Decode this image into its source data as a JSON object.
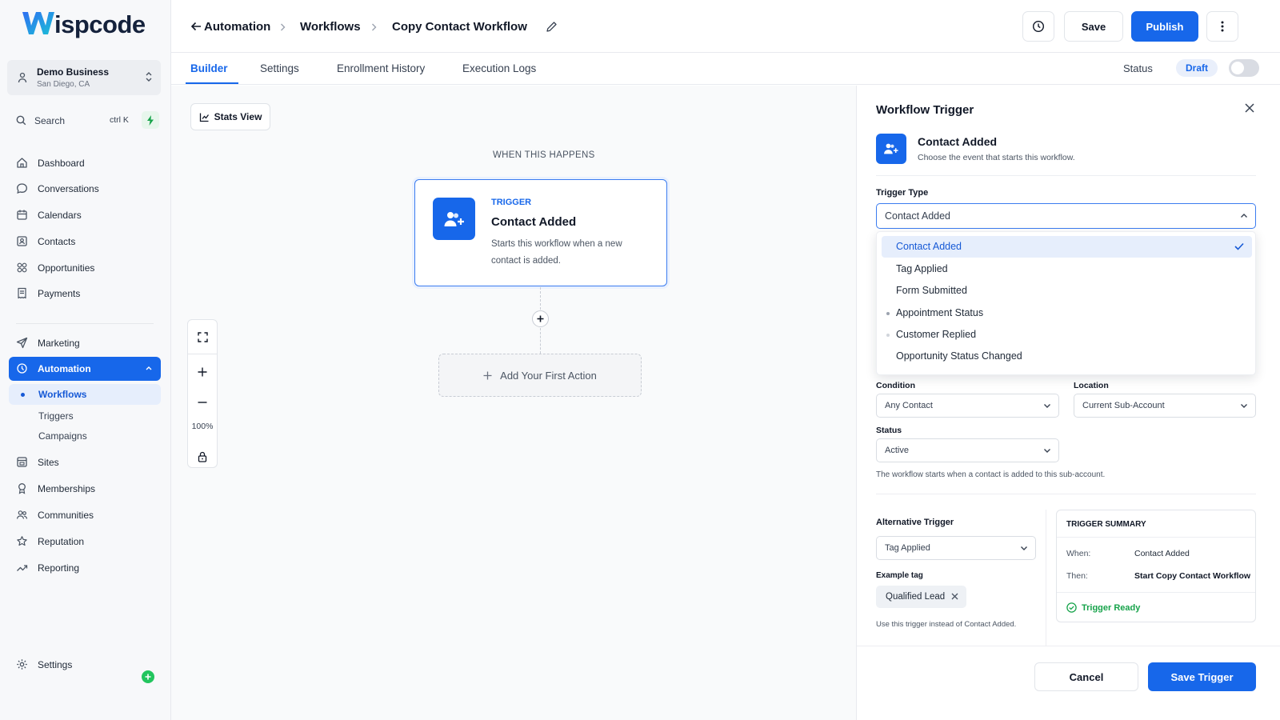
{
  "brand": {
    "name": "ispcode",
    "accent": "#1767ea"
  },
  "account": {
    "name": "Demo Business",
    "location": "San Diego, CA"
  },
  "search": {
    "placeholder": "Search",
    "shortcut": "ctrl K"
  },
  "nav": {
    "main": [
      {
        "label": "Dashboard",
        "icon": "home-icon"
      },
      {
        "label": "Conversations",
        "icon": "chat-icon"
      },
      {
        "label": "Calendars",
        "icon": "calendar-icon"
      },
      {
        "label": "Contacts",
        "icon": "contact-card-icon"
      },
      {
        "label": "Opportunities",
        "icon": "opportunities-icon"
      },
      {
        "label": "Payments",
        "icon": "receipt-icon"
      }
    ],
    "marketing": {
      "label": "Marketing",
      "icon": "send-icon"
    },
    "automation": {
      "label": "Automation",
      "icon": "automation-icon"
    },
    "automation_sub": [
      "Workflows",
      "Triggers",
      "Campaigns"
    ],
    "more": [
      {
        "label": "Sites",
        "icon": "browser-icon"
      },
      {
        "label": "Memberships",
        "icon": "award-icon"
      },
      {
        "label": "Communities",
        "icon": "users-icon"
      },
      {
        "label": "Reputation",
        "icon": "star-icon"
      },
      {
        "label": "Reporting",
        "icon": "trend-icon"
      }
    ],
    "settings": {
      "label": "Settings",
      "icon": "gear-icon"
    }
  },
  "header": {
    "breadcrumb": [
      "Automation",
      "Workflows",
      "Copy Contact Workflow"
    ],
    "save_label": "Save",
    "publish_label": "Publish"
  },
  "tabs": [
    "Builder",
    "Settings",
    "Enrollment History",
    "Execution Logs"
  ],
  "status": {
    "label": "Status",
    "value": "Draft",
    "toggle_on": false
  },
  "canvas": {
    "stats_view_label": "Stats View",
    "when_label": "WHEN THIS HAPPENS",
    "trigger_card": {
      "tag": "TRIGGER",
      "title": "Contact Added",
      "description": "Starts this workflow when a new contact is added."
    },
    "add_action_label": "Add Your First Action",
    "zoom_level": "100%"
  },
  "panel": {
    "title": "Workflow Trigger",
    "trigger_name": "Contact Added",
    "trigger_desc": "Choose the event that starts this workflow.",
    "trigger_type_label": "Trigger Type",
    "trigger_type_value": "Contact Added",
    "options": [
      "Contact Added",
      "Tag Applied",
      "Form Submitted",
      "Appointment Status",
      "Customer Replied",
      "Opportunity Status Changed"
    ],
    "condition_label": "Condition",
    "condition_value": "Any Contact",
    "location_label": "Location",
    "location_value": "Current Sub-Account",
    "status_label": "Status",
    "status_value": "Active",
    "status_hint": "The workflow starts when a contact is added to this sub-account.",
    "alt_trigger_label": "Alternative Trigger",
    "alt_trigger_value": "Tag Applied",
    "example_tag_label": "Example tag",
    "example_tag_value": "Qualified Lead",
    "alt_hint": "Use this trigger instead of Contact Added.",
    "summary": {
      "title": "TRIGGER SUMMARY",
      "when_key": "When:",
      "when_value": "Contact Added",
      "then_key": "Then:",
      "then_value": "Start Copy Contact Workflow",
      "ready": "Trigger Ready"
    },
    "cancel_label": "Cancel",
    "save_trigger_label": "Save Trigger"
  }
}
